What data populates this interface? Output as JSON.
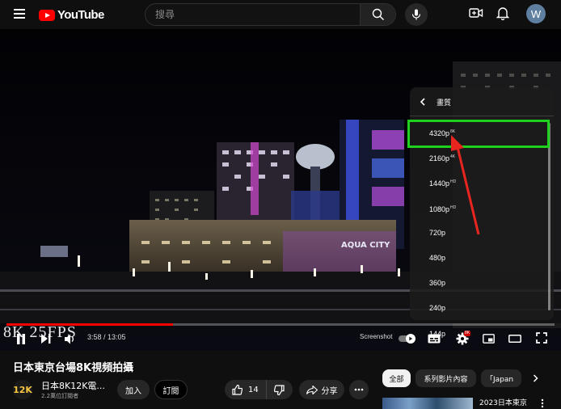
{
  "brand": {
    "name": "YouTube"
  },
  "search": {
    "placeholder": "搜尋"
  },
  "account": {
    "initial": "W"
  },
  "player": {
    "overlay_text": "8K 25FPS",
    "current_time": "3:58",
    "duration": "13:05",
    "time_display": "3:58 / 13:05",
    "progress_fraction": 0.304,
    "screenshot_label": "Screenshot",
    "settings_badge": "8K",
    "scene_sign": "AQUA CITY"
  },
  "quality_menu": {
    "title": "畫質",
    "options": [
      {
        "label": "4320p",
        "badge": "8K"
      },
      {
        "label": "2160p",
        "badge": "4K"
      },
      {
        "label": "1440p",
        "badge": "HD"
      },
      {
        "label": "1080p",
        "badge": "HD"
      },
      {
        "label": "720p",
        "badge": ""
      },
      {
        "label": "480p",
        "badge": ""
      },
      {
        "label": "360p",
        "badge": ""
      },
      {
        "label": "240p",
        "badge": ""
      },
      {
        "label": "144p",
        "badge": ""
      }
    ]
  },
  "video": {
    "title": "日本東京台場8K視頻拍攝",
    "channel_name": "日本8K12K電...",
    "channel_avatar_text": "12K",
    "subscribers": "2.2萬位訂閱者",
    "join_label": "加入",
    "subscribe_label": "訂閱",
    "like_count": "14",
    "share_label": "分享"
  },
  "recommendations": {
    "chips": [
      "全部",
      "系列影片內容",
      "「Japan"
    ],
    "first_title": "2023日本東京"
  },
  "colors": {
    "accent": "#ff0000",
    "highlight": "#1fd11f",
    "arrow": "#e8261f"
  }
}
